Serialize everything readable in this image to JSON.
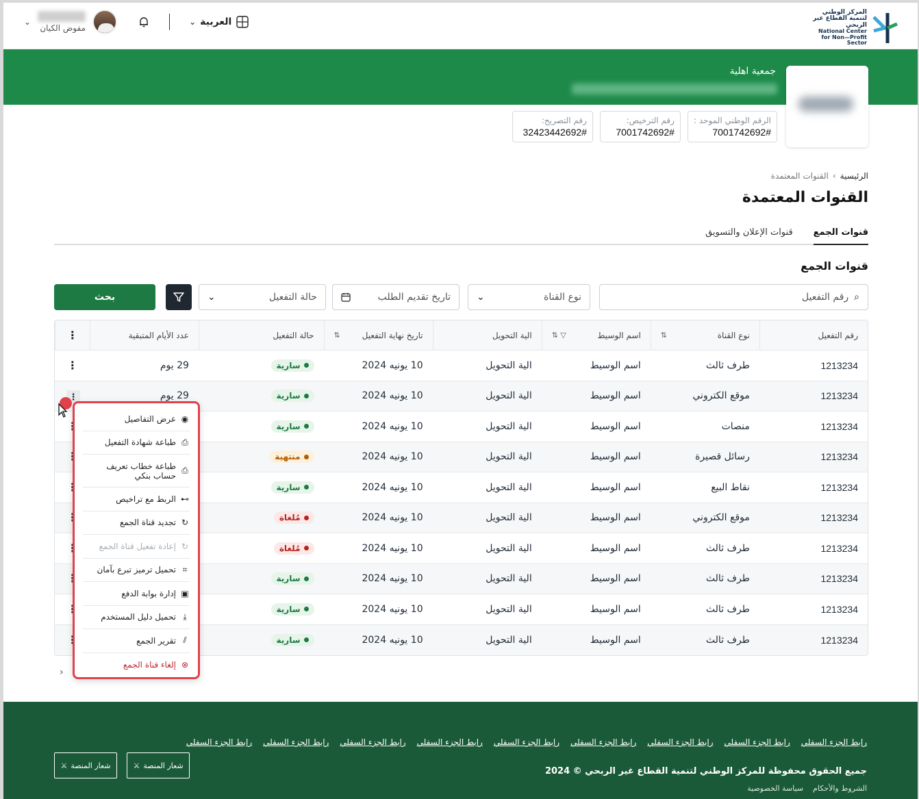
{
  "header": {
    "logo_ar": "المركز الوطني لتنمية القطاع غير الربحي",
    "logo_en": "National Center for Non—Profit Sector",
    "language": "العربية",
    "user_role": "مفوض الكيان"
  },
  "org": {
    "type": "جمعية اهلية",
    "unified_number_label": "الرقم الوطني الموحد :",
    "unified_number": "7001742692#",
    "license_label": "رقم الترخيص:",
    "license_number": "7001742692#",
    "permit_label": "رقم التصريح:",
    "permit_number": "32423442692#"
  },
  "breadcrumb": {
    "home": "الرئيسية",
    "separator": "›",
    "current": "القنوات المعتمدة"
  },
  "page_title": "القنوات المعتمدة",
  "tabs": [
    {
      "label": "قنوات الجمع",
      "active": true
    },
    {
      "label": "قنوات الإعلان والتسويق",
      "active": false
    }
  ],
  "section_title": "قنوات الجمع",
  "filters": {
    "activation_no_placeholder": "رقم التفعيل",
    "channel_type_placeholder": "نوع القناة",
    "request_date_placeholder": "تاريخ تقديم الطلب",
    "activation_status_placeholder": "حالة التفعيل",
    "search_label": "بحث"
  },
  "table": {
    "headers": [
      "رقم التفعيل",
      "نوع القناة",
      "اسم الوسيط",
      "الية التحويل",
      "تاريخ نهاية التفعيل",
      "حالة التفعيل",
      "عدد الأيام المتبقية"
    ],
    "rows": [
      {
        "id": "1213234",
        "type": "طرف ثالث",
        "broker": "اسم الوسيط",
        "transfer": "الية التحويل",
        "end": "10 يونيه 2024",
        "status": "سارية",
        "status_kind": "active",
        "days": "29 يوم"
      },
      {
        "id": "1213234",
        "type": "موقع الكتروني",
        "broker": "اسم الوسيط",
        "transfer": "الية التحويل",
        "end": "10 يونيه 2024",
        "status": "سارية",
        "status_kind": "active",
        "days": "29 يوم"
      },
      {
        "id": "1213234",
        "type": "منصات",
        "broker": "اسم الوسيط",
        "transfer": "الية التحويل",
        "end": "10 يونيه 2024",
        "status": "سارية",
        "status_kind": "active",
        "days": ""
      },
      {
        "id": "1213234",
        "type": "رسائل قصيرة",
        "broker": "اسم الوسيط",
        "transfer": "الية التحويل",
        "end": "10 يونيه 2024",
        "status": "منتهية",
        "status_kind": "expired",
        "days": ""
      },
      {
        "id": "1213234",
        "type": "نقاط البيع",
        "broker": "اسم الوسيط",
        "transfer": "الية التحويل",
        "end": "10 يونيه 2024",
        "status": "سارية",
        "status_kind": "active",
        "days": ""
      },
      {
        "id": "1213234",
        "type": "موقع الكتروني",
        "broker": "اسم الوسيط",
        "transfer": "الية التحويل",
        "end": "10 يونيه 2024",
        "status": "مُلغاة",
        "status_kind": "cancelled",
        "days": ""
      },
      {
        "id": "1213234",
        "type": "طرف ثالث",
        "broker": "اسم الوسيط",
        "transfer": "الية التحويل",
        "end": "10 يونيه 2024",
        "status": "مُلغاة",
        "status_kind": "cancelled",
        "days": ""
      },
      {
        "id": "1213234",
        "type": "طرف ثالث",
        "broker": "اسم الوسيط",
        "transfer": "الية التحويل",
        "end": "10 يونيه 2024",
        "status": "سارية",
        "status_kind": "active",
        "days": ""
      },
      {
        "id": "1213234",
        "type": "طرف ثالث",
        "broker": "اسم الوسيط",
        "transfer": "الية التحويل",
        "end": "10 يونيه 2024",
        "status": "سارية",
        "status_kind": "active",
        "days": ""
      },
      {
        "id": "1213234",
        "type": "طرف ثالث",
        "broker": "اسم الوسيط",
        "transfer": "الية التحويل",
        "end": "10 يونيه 2024",
        "status": "سارية",
        "status_kind": "active",
        "days": ""
      }
    ]
  },
  "status_colors": {
    "active": {
      "bg": "#e6f4ea",
      "fg": "#1e7a43",
      "dot": "#1e7a43"
    },
    "expired": {
      "bg": "#fdf0dc",
      "fg": "#b35c00",
      "dot": "#b35c00"
    },
    "cancelled": {
      "bg": "#fce8e8",
      "fg": "#b3261e",
      "dot": "#b3261e"
    }
  },
  "context_menu": [
    {
      "label": "عرض التفاصيل",
      "icon": "eye-icon",
      "glyph": "◉",
      "state": "normal"
    },
    {
      "label": "طباعة شهادة التفعيل",
      "icon": "printer-icon",
      "glyph": "⎙",
      "state": "normal"
    },
    {
      "label": "طباعة خطاب تعريف حساب بنكي",
      "icon": "printer-icon",
      "glyph": "⎙",
      "state": "normal"
    },
    {
      "label": "الربط مع تراخيص",
      "icon": "link-tree-icon",
      "glyph": "⊶",
      "state": "normal"
    },
    {
      "label": "تجديد قناة الجمع",
      "icon": "refresh-icon",
      "glyph": "↻",
      "state": "normal"
    },
    {
      "label": "إعادة تفعيل قناة الجمع",
      "icon": "refresh-icon",
      "glyph": "↻",
      "state": "disabled"
    },
    {
      "label": "تحميل ترميز تبرع بآمان",
      "icon": "qr-download-icon",
      "glyph": "⌗",
      "state": "normal"
    },
    {
      "label": "إدارة بوابة الدفع",
      "icon": "payment-gateway-icon",
      "glyph": "▣",
      "state": "normal"
    },
    {
      "label": "تحميل دليل المستخدم",
      "icon": "download-icon",
      "glyph": "⤓",
      "state": "normal"
    },
    {
      "label": "تقرير الجمع",
      "icon": "chart-icon",
      "glyph": "⫽",
      "state": "normal"
    },
    {
      "label": "إلغاء قناة الجمع",
      "icon": "cancel-circle-icon",
      "glyph": "⊗",
      "state": "danger"
    }
  ],
  "pager": {
    "prev": "‹"
  },
  "footer": {
    "links": [
      "رابط الجزء السفلي",
      "رابط الجزء السفلي",
      "رابط الجزء السفلي",
      "رابط الجزء السفلي",
      "رابط الجزء السفلي",
      "رابط الجزء السفلي",
      "رابط الجزء السفلي",
      "رابط الجزء السفلي",
      "رابط الجزء السفلي"
    ],
    "copyright": "جميع الحقوق محفوظة للمركز الوطني لتنمية القطاع غير الربحي © 2024",
    "terms": "الشروط والأحكام",
    "privacy": "سياسة الخصوصية",
    "platform_logo_1": "شعار المنصة",
    "platform_logo_2": "شعار المنصة"
  },
  "colors": {
    "brand_green": "#1e8a4a",
    "button_green": "#1e7a43",
    "footer_green": "#1b5a38",
    "highlight_red": "#e0414a"
  }
}
